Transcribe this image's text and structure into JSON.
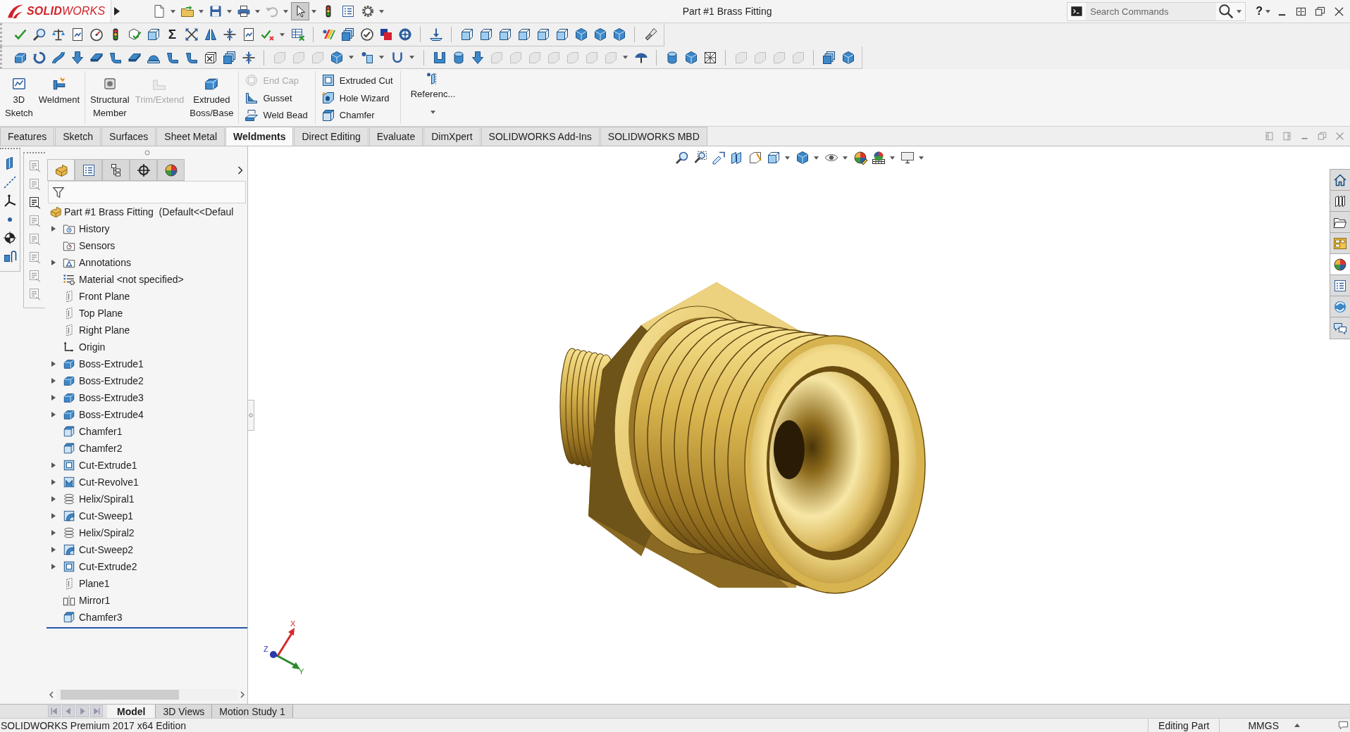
{
  "title_bar": {
    "logo": "**SOLID**WORKS",
    "quick_access": [
      {
        "kind": "new",
        "menu": true,
        "disabled": false,
        "pressed": false
      },
      {
        "kind": "open",
        "menu": true,
        "disabled": false,
        "pressed": false
      },
      {
        "kind": "save",
        "menu": true,
        "disabled": false,
        "pressed": false
      },
      {
        "kind": "print",
        "menu": true,
        "disabled": false,
        "pressed": false
      },
      {
        "kind": "undo",
        "menu": true,
        "disabled": true,
        "pressed": false
      },
      {
        "kind": "select",
        "menu": true,
        "disabled": false,
        "pressed": true
      },
      {
        "kind": "rebuild",
        "menu": false,
        "disabled": false,
        "pressed": false
      },
      {
        "kind": "properties",
        "menu": false,
        "disabled": false,
        "pressed": false
      },
      {
        "kind": "options",
        "menu": true,
        "disabled": false,
        "pressed": false
      }
    ],
    "document_title": "Part #1 Brass Fitting",
    "search": {
      "placeholder": "Search Commands"
    },
    "help": "?"
  },
  "toolbars": [
    {
      "groups": [
        [
          {
            "kind": "tick",
            "disabled": false,
            "menu": false
          },
          {
            "kind": "magnifier",
            "disabled": false,
            "menu": false
          },
          {
            "kind": "scale",
            "disabled": false,
            "menu": false
          },
          {
            "kind": "sheet",
            "disabled": false,
            "menu": false
          },
          {
            "kind": "gauge",
            "disabled": false,
            "menu": false
          },
          {
            "kind": "rebuild",
            "disabled": false,
            "menu": false
          },
          {
            "kind": "cube_tick",
            "disabled": false,
            "menu": false
          },
          {
            "kind": "wire_cube",
            "disabled": false,
            "menu": false
          },
          {
            "kind": "glyph",
            "glyph": "Σ",
            "disabled": false,
            "menu": false
          },
          {
            "kind": "cross_arrows",
            "disabled": false,
            "menu": false
          },
          {
            "kind": "mirror",
            "disabled": false,
            "menu": false
          },
          {
            "kind": "compress",
            "disabled": false,
            "menu": false
          },
          {
            "kind": "sheet",
            "disabled": false,
            "menu": false
          },
          {
            "kind": "check_cross",
            "disabled": false,
            "menu": true
          },
          {
            "kind": "table_x",
            "disabled": false,
            "menu": false
          }
        ],
        [
          {
            "kind": "stripes",
            "disabled": false,
            "menu": false
          },
          {
            "kind": "stack",
            "disabled": false,
            "menu": false
          },
          {
            "kind": "circle_tick",
            "disabled": false,
            "menu": false
          },
          {
            "kind": "squares",
            "disabled": false,
            "menu": false
          },
          {
            "kind": "wheel",
            "disabled": false,
            "menu": false
          }
        ],
        [
          {
            "kind": "anchor",
            "disabled": false,
            "menu": false
          }
        ],
        [
          {
            "kind": "wire_cube",
            "disabled": false,
            "menu": false
          },
          {
            "kind": "wire_cube",
            "disabled": false,
            "menu": false
          },
          {
            "kind": "wire_cube",
            "disabled": false,
            "menu": false
          },
          {
            "kind": "wire_cube",
            "disabled": false,
            "menu": false
          },
          {
            "kind": "wire_cube",
            "disabled": false,
            "menu": false
          },
          {
            "kind": "wire_cube",
            "disabled": false,
            "menu": false
          },
          {
            "kind": "cube",
            "disabled": false,
            "menu": false
          },
          {
            "kind": "cube",
            "disabled": false,
            "menu": false
          },
          {
            "kind": "cube",
            "disabled": false,
            "menu": false
          }
        ],
        [
          {
            "kind": "flashlight",
            "disabled": false,
            "menu": false
          }
        ]
      ]
    },
    {
      "groups": [
        [
          {
            "kind": "extrude",
            "disabled": false,
            "menu": false
          },
          {
            "kind": "revolve",
            "disabled": false,
            "menu": false
          },
          {
            "kind": "sweep",
            "disabled": false,
            "menu": false
          },
          {
            "kind": "arrow_down",
            "disabled": false,
            "menu": false
          },
          {
            "kind": "plate",
            "disabled": false,
            "menu": false
          },
          {
            "kind": "bend",
            "disabled": false,
            "menu": false
          },
          {
            "kind": "plate",
            "disabled": false,
            "menu": false
          },
          {
            "kind": "dome",
            "disabled": false,
            "menu": false
          },
          {
            "kind": "bend",
            "disabled": false,
            "menu": false
          },
          {
            "kind": "bend",
            "disabled": false,
            "menu": false
          },
          {
            "kind": "cube_x",
            "disabled": false,
            "menu": false
          },
          {
            "kind": "stack",
            "disabled": false,
            "menu": false
          },
          {
            "kind": "compress",
            "disabled": false,
            "menu": false
          }
        ],
        [
          {
            "kind": "shape",
            "disabled": true,
            "menu": false
          },
          {
            "kind": "shape",
            "disabled": true,
            "menu": false
          },
          {
            "kind": "shape",
            "disabled": true,
            "menu": false
          },
          {
            "kind": "cube",
            "disabled": false,
            "menu": true
          },
          {
            "kind": "pin",
            "disabled": false,
            "menu": true
          },
          {
            "kind": "hook",
            "disabled": false,
            "menu": true
          }
        ],
        [
          {
            "kind": "bracket",
            "disabled": false,
            "menu": false
          },
          {
            "kind": "tube",
            "disabled": false,
            "menu": false
          },
          {
            "kind": "arrow_down",
            "disabled": false,
            "menu": false
          },
          {
            "kind": "shape",
            "disabled": true,
            "menu": false
          },
          {
            "kind": "shape",
            "disabled": true,
            "menu": false
          },
          {
            "kind": "shape",
            "disabled": true,
            "menu": false
          },
          {
            "kind": "shape",
            "disabled": true,
            "menu": false
          },
          {
            "kind": "shape",
            "disabled": true,
            "menu": false
          },
          {
            "kind": "shape",
            "disabled": true,
            "menu": false
          },
          {
            "kind": "shape",
            "disabled": true,
            "menu": true
          },
          {
            "kind": "umbrella",
            "disabled": false,
            "menu": false
          }
        ],
        [
          {
            "kind": "tube",
            "disabled": false,
            "menu": false
          },
          {
            "kind": "cube",
            "disabled": false,
            "menu": false
          },
          {
            "kind": "grid",
            "disabled": false,
            "menu": false
          }
        ],
        [
          {
            "kind": "shape",
            "disabled": true,
            "menu": false
          },
          {
            "kind": "shape",
            "disabled": true,
            "menu": false
          },
          {
            "kind": "shape",
            "disabled": true,
            "menu": false
          },
          {
            "kind": "shape",
            "disabled": true,
            "menu": false
          }
        ],
        [
          {
            "kind": "stack",
            "disabled": false,
            "menu": false
          },
          {
            "kind": "cube",
            "disabled": false,
            "menu": false
          }
        ]
      ]
    }
  ],
  "command_manager": {
    "large_groups": [
      [
        {
          "kind": "sketch3d",
          "label": "3D Sketch",
          "disabled": false
        },
        {
          "kind": "weldment",
          "label": "Weldment",
          "disabled": false
        }
      ],
      [
        {
          "kind": "structural",
          "label": "Structural Member",
          "disabled": false
        },
        {
          "kind": "trim",
          "label": "Trim/Extend",
          "disabled": true
        },
        {
          "kind": "extrude",
          "label": "Extruded Boss/Base",
          "disabled": false
        }
      ]
    ],
    "small_columns": [
      [
        {
          "kind": "end_cap",
          "label": "End Cap",
          "disabled": true
        },
        {
          "kind": "gusset",
          "label": "Gusset",
          "disabled": false
        },
        {
          "kind": "weld_bead",
          "label": "Weld Bead",
          "disabled": false
        }
      ],
      [
        {
          "kind": "cut_extrude",
          "label": "Extruded Cut",
          "disabled": false
        },
        {
          "kind": "hole_wizard",
          "label": "Hole Wizard",
          "disabled": false
        },
        {
          "kind": "chamfer",
          "label": "Chamfer",
          "disabled": false
        }
      ]
    ],
    "reference": {
      "kind": "reference",
      "label": "Referenc...",
      "menu": true
    }
  },
  "tabs": [
    {
      "label": "Features",
      "selected": false
    },
    {
      "label": "Sketch",
      "selected": false
    },
    {
      "label": "Surfaces",
      "selected": false
    },
    {
      "label": "Sheet Metal",
      "selected": false
    },
    {
      "label": "Weldments",
      "selected": true
    },
    {
      "label": "Direct Editing",
      "selected": false
    },
    {
      "label": "Evaluate",
      "selected": false
    },
    {
      "label": "DimXpert",
      "selected": false
    },
    {
      "label": "SOLIDWORKS Add-Ins",
      "selected": false
    },
    {
      "label": "SOLIDWORKS MBD",
      "selected": false
    }
  ],
  "annotation_tools": [
    {
      "disabled": true
    },
    {
      "disabled": true
    },
    {
      "disabled": false
    },
    {
      "disabled": true
    },
    {
      "disabled": true
    },
    {
      "disabled": true
    },
    {
      "disabled": true
    },
    {
      "disabled": true
    }
  ],
  "feature_tree": {
    "tabs": [
      {
        "kind": "feature_manager",
        "selected": true
      },
      {
        "kind": "property_manager",
        "selected": false
      },
      {
        "kind": "configuration_manager",
        "selected": false
      },
      {
        "kind": "dimxpert",
        "selected": false
      },
      {
        "kind": "display_manager",
        "selected": false
      }
    ],
    "root": {
      "kind": "part",
      "label": "Part #1 Brass Fitting  (Default<<Defaul"
    },
    "items": [
      {
        "kind": "history",
        "label": "History",
        "expandable": true
      },
      {
        "kind": "sensors",
        "label": "Sensors",
        "expandable": false
      },
      {
        "kind": "annotations",
        "label": "Annotations",
        "expandable": true
      },
      {
        "kind": "material",
        "label": "Material <not specified>",
        "expandable": false
      },
      {
        "kind": "plane",
        "label": "Front Plane",
        "expandable": false
      },
      {
        "kind": "plane",
        "label": "Top Plane",
        "expandable": false
      },
      {
        "kind": "plane",
        "label": "Right Plane",
        "expandable": false
      },
      {
        "kind": "origin",
        "label": "Origin",
        "expandable": false
      },
      {
        "kind": "boss_extrude",
        "label": "Boss-Extrude1",
        "expandable": true
      },
      {
        "kind": "boss_extrude",
        "label": "Boss-Extrude2",
        "expandable": true
      },
      {
        "kind": "boss_extrude",
        "label": "Boss-Extrude3",
        "expandable": true
      },
      {
        "kind": "boss_extrude",
        "label": "Boss-Extrude4",
        "expandable": true
      },
      {
        "kind": "chamfer",
        "label": "Chamfer1",
        "expandable": false
      },
      {
        "kind": "chamfer",
        "label": "Chamfer2",
        "expandable": false
      },
      {
        "kind": "cut_extrude",
        "label": "Cut-Extrude1",
        "expandable": true
      },
      {
        "kind": "cut_revolve",
        "label": "Cut-Revolve1",
        "expandable": true
      },
      {
        "kind": "helix",
        "label": "Helix/Spiral1",
        "expandable": true
      },
      {
        "kind": "cut_sweep",
        "label": "Cut-Sweep1",
        "expandable": true
      },
      {
        "kind": "helix",
        "label": "Helix/Spiral2",
        "expandable": true
      },
      {
        "kind": "cut_sweep",
        "label": "Cut-Sweep2",
        "expandable": true
      },
      {
        "kind": "cut_extrude",
        "label": "Cut-Extrude2",
        "expandable": true
      },
      {
        "kind": "plane",
        "label": "Plane1",
        "expandable": false
      },
      {
        "kind": "mirror_feature",
        "label": "Mirror1",
        "expandable": false
      },
      {
        "kind": "chamfer",
        "label": "Chamfer3",
        "expandable": false
      }
    ]
  },
  "triad": {
    "x": "X",
    "y": "Y",
    "z": "Z"
  },
  "task_pane": [
    {
      "kind": "home",
      "selected": false
    },
    {
      "kind": "design_library",
      "selected": false
    },
    {
      "kind": "file_explorer",
      "selected": false
    },
    {
      "kind": "view_palette",
      "selected": false
    },
    {
      "kind": "appearances",
      "selected": true
    },
    {
      "kind": "custom_properties",
      "selected": false
    },
    {
      "kind": "forum",
      "selected": false
    },
    {
      "kind": "chat",
      "selected": false
    }
  ],
  "bottom_bar": {
    "nav": [
      {
        "kind": "first",
        "disabled": true
      },
      {
        "kind": "previous",
        "disabled": true
      },
      {
        "kind": "next",
        "disabled": true
      },
      {
        "kind": "last",
        "disabled": true
      }
    ],
    "tabs": [
      {
        "label": "Model",
        "selected": true
      },
      {
        "label": "3D Views",
        "selected": false
      },
      {
        "label": "Motion Study 1",
        "selected": false
      }
    ]
  },
  "status_bar": {
    "edition": "SOLIDWORKS Premium 2017 x64 Edition",
    "mode": "Editing Part",
    "units": "MMGS"
  }
}
